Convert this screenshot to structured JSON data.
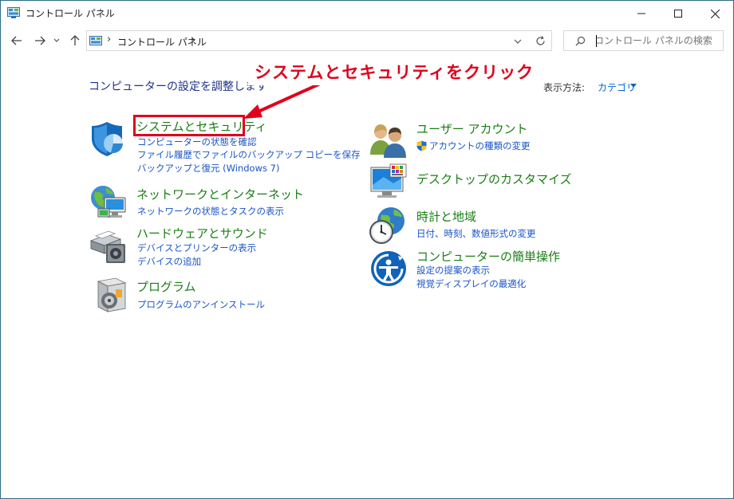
{
  "window": {
    "title": "コントロール パネル"
  },
  "address_bar": {
    "crumb": "コントロール パネル",
    "separator": "›"
  },
  "search": {
    "placeholder": "コントロール パネルの検索"
  },
  "content": {
    "heading": "コンピューターの設定を調整します",
    "view_by_label": "表示方法:",
    "view_by_value": "カテゴリ"
  },
  "categories_left": [
    {
      "title": "システムとセキュリティ",
      "links": [
        "コンピューターの状態を確認",
        "ファイル履歴でファイルのバックアップ コピーを保存",
        "バックアップと復元 (Windows 7)"
      ]
    },
    {
      "title": "ネットワークとインターネット",
      "links": [
        "ネットワークの状態とタスクの表示"
      ]
    },
    {
      "title": "ハードウェアとサウンド",
      "links": [
        "デバイスとプリンターの表示",
        "デバイスの追加"
      ]
    },
    {
      "title": "プログラム",
      "links": [
        "プログラムのアンインストール"
      ]
    }
  ],
  "categories_right": [
    {
      "title": "ユーザー アカウント",
      "links": [
        "アカウントの種類の変更"
      ]
    },
    {
      "title": "デスクトップのカスタマイズ",
      "links": []
    },
    {
      "title": "時計と地域",
      "links": [
        "日付、時刻、数値形式の変更"
      ]
    },
    {
      "title": "コンピューターの簡単操作",
      "links": [
        "設定の提案の表示",
        "視覚ディスプレイの最適化"
      ]
    }
  ],
  "annotation": {
    "callout_text": "システムとセキュリティをクリック",
    "color": "#e0001b"
  },
  "colors": {
    "category_title": "#1a7e14",
    "link": "#1a55c7",
    "heading": "#1e3287"
  }
}
